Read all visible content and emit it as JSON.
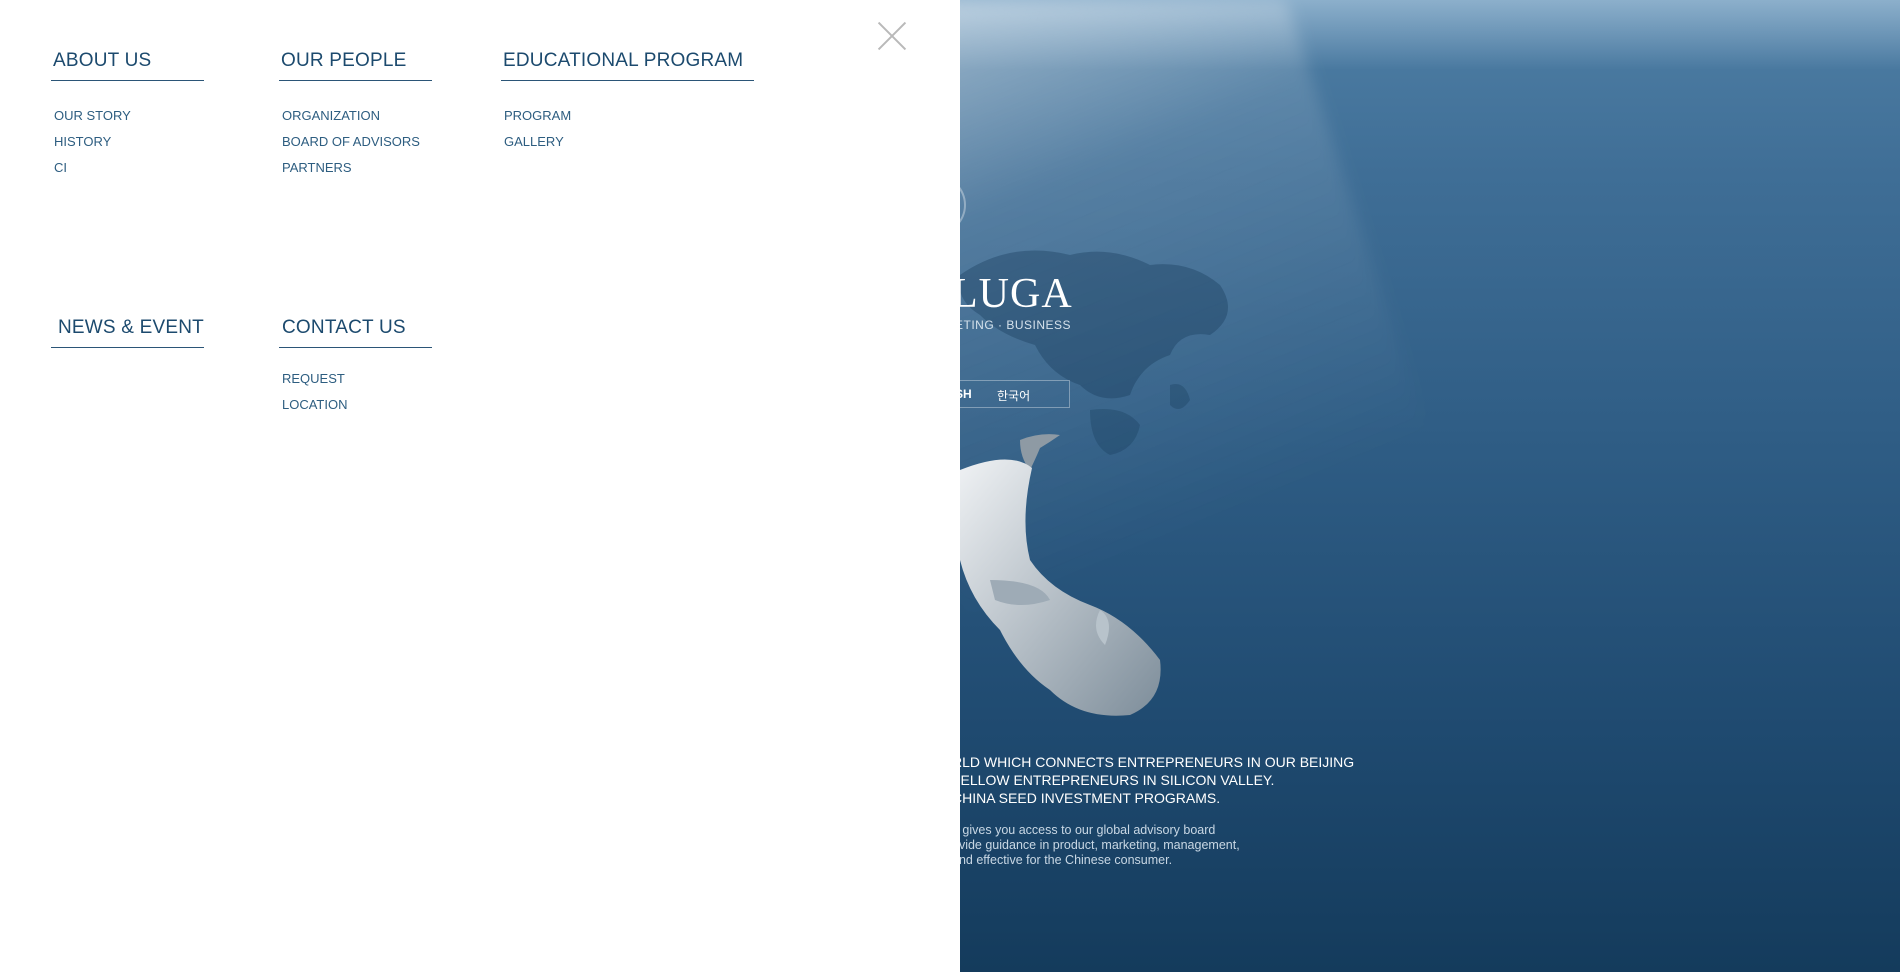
{
  "menu": {
    "close_icon": "close-icon",
    "sections": [
      {
        "heading": "ABOUT US",
        "links": [
          "OUR STORY",
          "HISTORY",
          "CI"
        ]
      },
      {
        "heading": "OUR PEOPLE",
        "links": [
          "ORGANIZATION",
          "BOARD OF ADVISORS",
          "PARTNERS"
        ]
      },
      {
        "heading": "EDUCATIONAL PROGRAM",
        "links": [
          "PROGRAM",
          "GALLERY"
        ]
      },
      {
        "heading": "NEWS & EVENT",
        "links": []
      },
      {
        "heading": "CONTACT US",
        "links": [
          "REQUEST",
          "LOCATION"
        ]
      }
    ]
  },
  "hero": {
    "logo": "LUGA",
    "tagline": "ETING · BUSINESS",
    "lang_1": "SH",
    "lang_2": "한국어",
    "headline_1": "RLD WHICH CONNECTS ENTREPRENEURS IN OUR BEIJING",
    "headline_2": "FELLOW ENTREPRENEURS IN SILICON VALLEY.",
    "headline_3": " CHINA SEED INVESTMENT PROGRAMS.",
    "body_1": "n gives you access to our global advisory board",
    "body_2": "ovide guidance in product, marketing, management,",
    "body_3": "and effective for the Chinese consumer."
  },
  "colors": {
    "menu_text": "#1c4a6e",
    "menu_link": "#2d5d80",
    "ocean_dark": "#143b5c",
    "ocean_light": "#4f7fa5"
  }
}
